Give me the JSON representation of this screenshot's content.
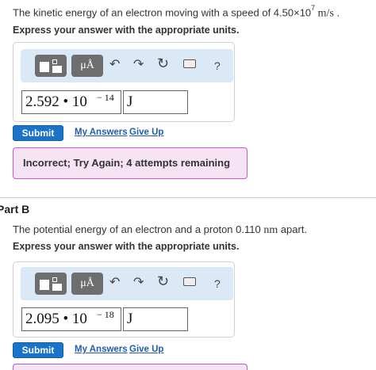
{
  "part_a": {
    "prompt_prefix": "The kinetic energy of an electron moving with a speed of 4.50×10",
    "prompt_exp": "7",
    "prompt_unit": " m/s",
    "prompt_suffix": " .",
    "instruction": "Express your answer with the appropriate units.",
    "toolbar": {
      "symbols_label": "μÅ",
      "undo_icon": "↶",
      "redo_icon": "↷",
      "reset_icon": "↻",
      "help_icon": "?"
    },
    "answer": {
      "mantissa": "2.592 • 10",
      "exponent": "− 14",
      "unit": "J"
    },
    "submit_label": "Submit",
    "my_answers_label": "My Answers",
    "give_up_label": "Give Up",
    "feedback": "Incorrect; Try Again; 4 attempts remaining"
  },
  "part_b": {
    "title": "Part B",
    "prompt_prefix": "The potential energy of an electron and a proton 0.110 ",
    "prompt_unit": "nm",
    "prompt_suffix": " apart.",
    "instruction": "Express your answer with the appropriate units.",
    "toolbar": {
      "symbols_label": "μÅ",
      "undo_icon": "↶",
      "redo_icon": "↷",
      "reset_icon": "↻",
      "help_icon": "?"
    },
    "answer": {
      "mantissa": "2.095 • 10",
      "exponent": "− 18",
      "unit": "J"
    },
    "submit_label": "Submit",
    "my_answers_label": "My Answers",
    "give_up_label": "Give Up"
  },
  "colors": {
    "toolbar_bg": "#dbe9f7",
    "submit_bg": "#1a73c8",
    "link": "#1f5fa8",
    "feedback_border": "#c25abf",
    "feedback_bg": "#f6e4f5"
  }
}
